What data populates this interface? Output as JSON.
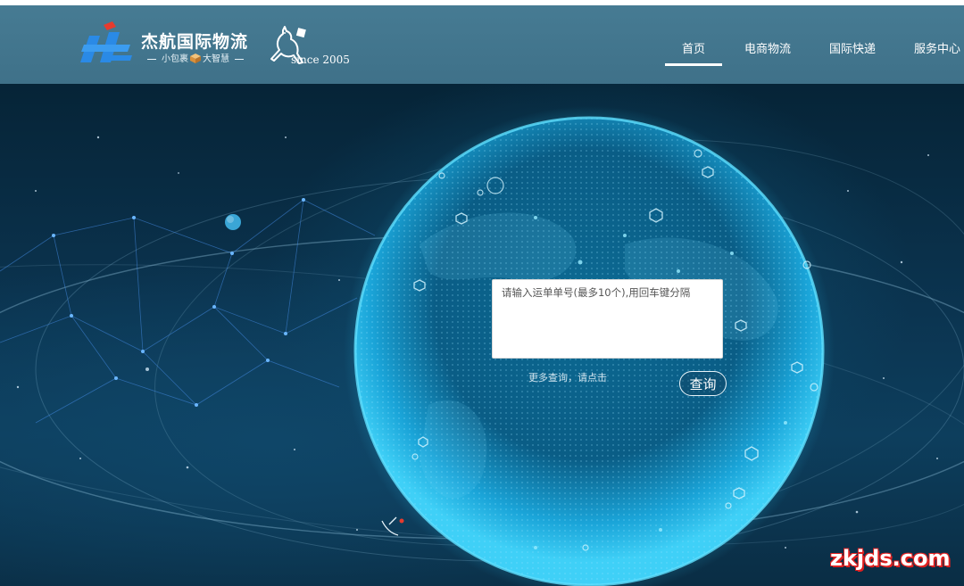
{
  "header": {
    "brand_name": "杰航国际物流",
    "slogan_left": "小包裹",
    "slogan_right": "大智慧",
    "since": "since 2005"
  },
  "nav": {
    "items": [
      {
        "label": "首页",
        "active": true
      },
      {
        "label": "电商物流",
        "active": false
      },
      {
        "label": "国际快递",
        "active": false
      },
      {
        "label": "服务中心",
        "active": false
      }
    ]
  },
  "query": {
    "placeholder": "请输入运单单号(最多10个),用回车键分隔",
    "value": "",
    "more_link": "更多查询，请点击",
    "button_label": "查询"
  },
  "watermark": "zkjds.com",
  "colors": {
    "header_bg": "#467b93",
    "logo_blue": "#2a8ae6",
    "logo_red": "#e63b2e",
    "globe_glow": "#28c3f0"
  },
  "icons": {
    "logo": "jh-logo-icon",
    "box": "package-box-icon",
    "kangaroo": "kangaroo-icon"
  }
}
